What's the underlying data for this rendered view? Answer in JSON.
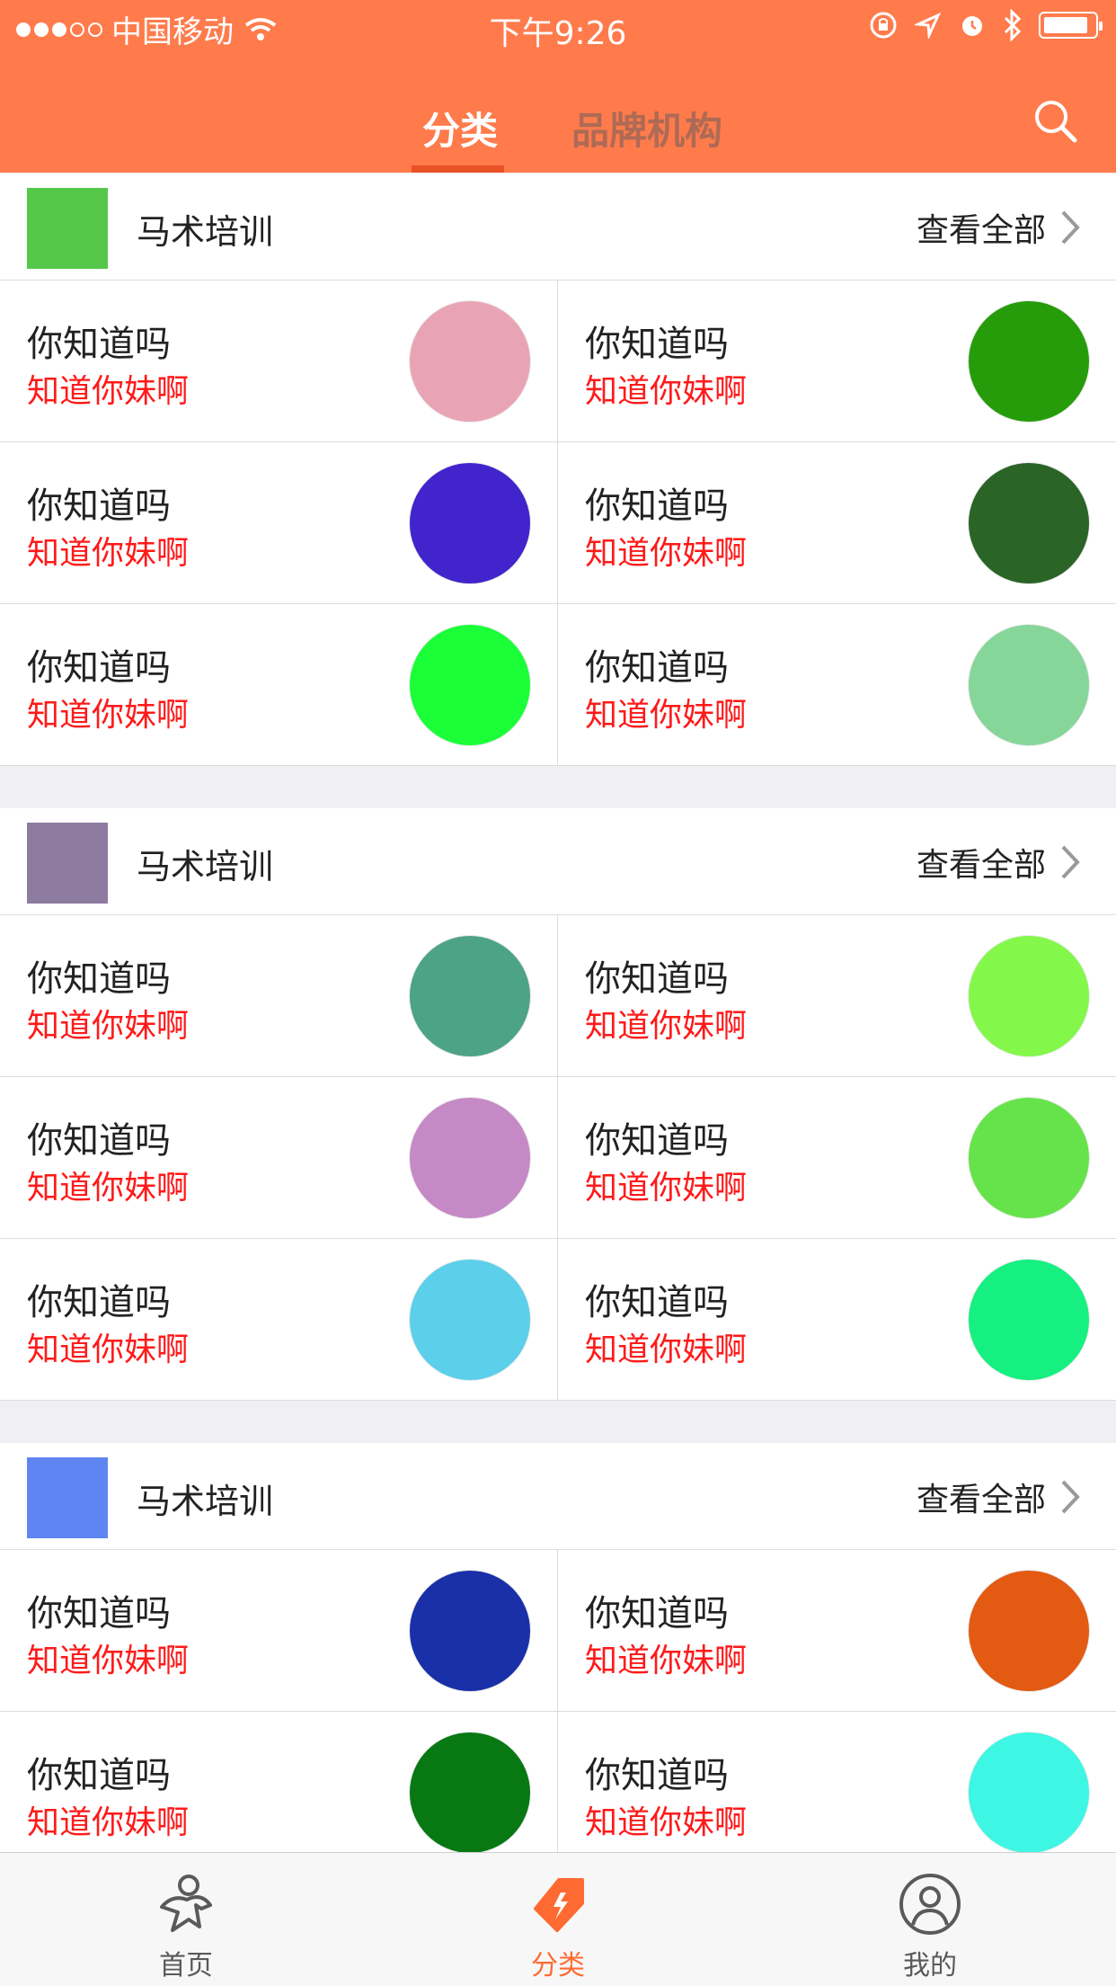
{
  "status_bar": {
    "carrier": "中国移动",
    "time": "下午9:26"
  },
  "nav": {
    "tabs": [
      {
        "label": "分类",
        "active": true
      },
      {
        "label": "品牌机构",
        "active": false
      }
    ],
    "search_icon": "search-icon"
  },
  "sections": [
    {
      "title": "马术培训",
      "see_all": "查看全部",
      "icon_color": "#55c84a",
      "items": [
        {
          "title": "你知道吗",
          "subtitle": "知道你妹啊",
          "color": "#e8a4b5"
        },
        {
          "title": "你知道吗",
          "subtitle": "知道你妹啊",
          "color": "#269c0a"
        },
        {
          "title": "你知道吗",
          "subtitle": "知道你妹啊",
          "color": "#4124cc"
        },
        {
          "title": "你知道吗",
          "subtitle": "知道你妹啊",
          "color": "#2a6426"
        },
        {
          "title": "你知道吗",
          "subtitle": "知道你妹啊",
          "color": "#1aff38"
        },
        {
          "title": "你知道吗",
          "subtitle": "知道你妹啊",
          "color": "#86d69a"
        }
      ]
    },
    {
      "title": "马术培训",
      "see_all": "查看全部",
      "icon_color": "#8d7ba0",
      "items": [
        {
          "title": "你知道吗",
          "subtitle": "知道你妹啊",
          "color": "#4da385"
        },
        {
          "title": "你知道吗",
          "subtitle": "知道你妹啊",
          "color": "#83f84a"
        },
        {
          "title": "你知道吗",
          "subtitle": "知道你妹啊",
          "color": "#c589c5"
        },
        {
          "title": "你知道吗",
          "subtitle": "知道你妹啊",
          "color": "#66e34b"
        },
        {
          "title": "你知道吗",
          "subtitle": "知道你妹啊",
          "color": "#5ccfea"
        },
        {
          "title": "你知道吗",
          "subtitle": "知道你妹啊",
          "color": "#15f080"
        }
      ]
    },
    {
      "title": "马术培训",
      "see_all": "查看全部",
      "icon_color": "#5f85f2",
      "items": [
        {
          "title": "你知道吗",
          "subtitle": "知道你妹啊",
          "color": "#1a30a8"
        },
        {
          "title": "你知道吗",
          "subtitle": "知道你妹啊",
          "color": "#e35a12"
        },
        {
          "title": "你知道吗",
          "subtitle": "知道你妹啊",
          "color": "#077812"
        },
        {
          "title": "你知道吗",
          "subtitle": "知道你妹啊",
          "color": "#3ef6e4"
        }
      ]
    }
  ],
  "tabbar": {
    "items": [
      {
        "label": "首页",
        "icon": "home-person-icon",
        "active": false
      },
      {
        "label": "分类",
        "icon": "tag-flash-icon",
        "active": true
      },
      {
        "label": "我的",
        "icon": "profile-icon",
        "active": false
      }
    ],
    "active_color": "#ff6a33",
    "inactive_color": "#5a5a5a"
  }
}
